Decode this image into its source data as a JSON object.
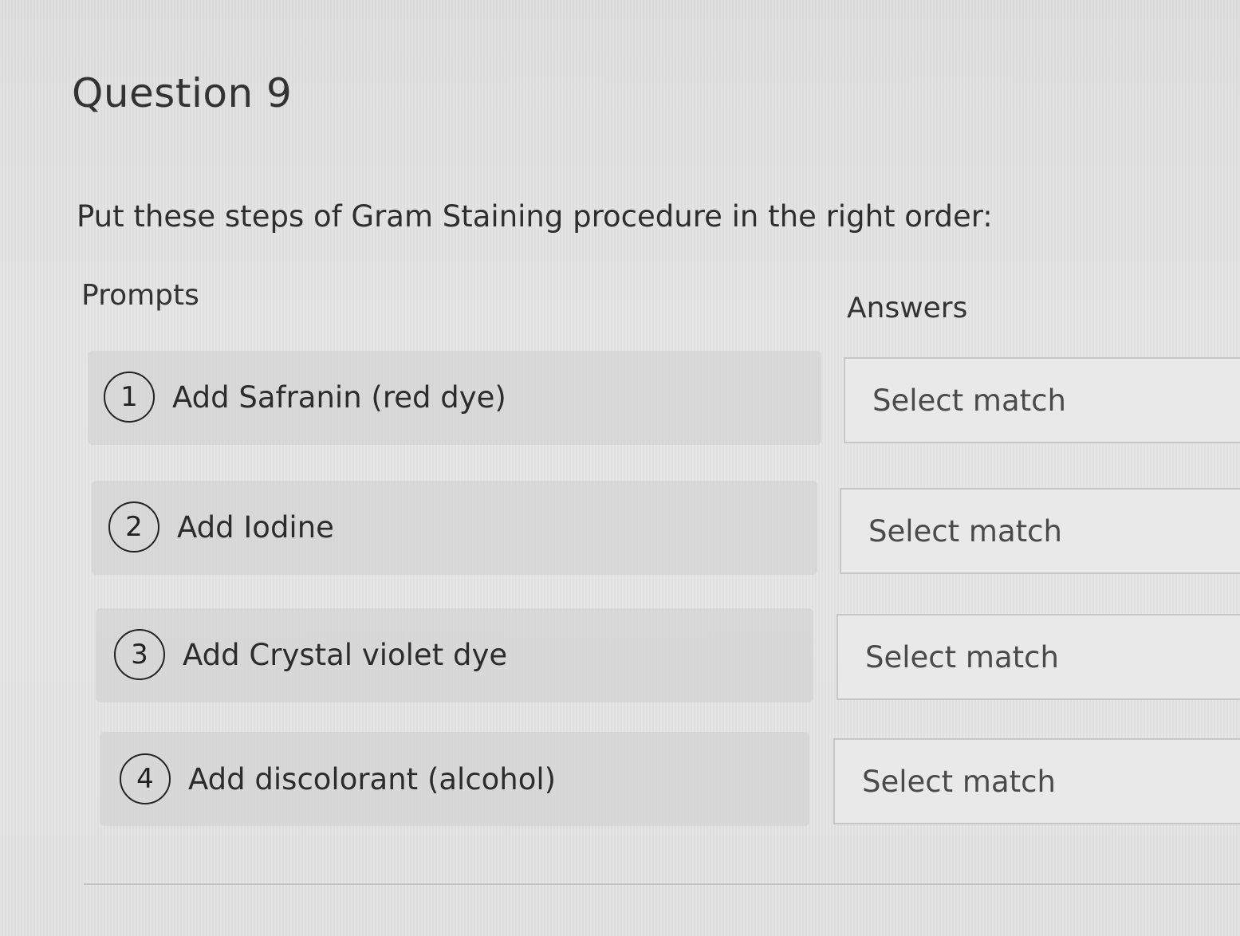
{
  "question": {
    "title": "Question 9",
    "instructions": "Put these steps of Gram Staining procedure in the right order:"
  },
  "columns": {
    "prompts": "Prompts",
    "answers": "Answers"
  },
  "prompts": [
    {
      "number": "1",
      "text": "Add Safranin (red dye)",
      "answer": "Select match"
    },
    {
      "number": "2",
      "text": "Add Iodine",
      "answer": "Select match"
    },
    {
      "number": "3",
      "text": "Add Crystal violet dye",
      "answer": "Select match"
    },
    {
      "number": "4",
      "text": "Add discolorant (alcohol)",
      "answer": "Select match"
    }
  ]
}
